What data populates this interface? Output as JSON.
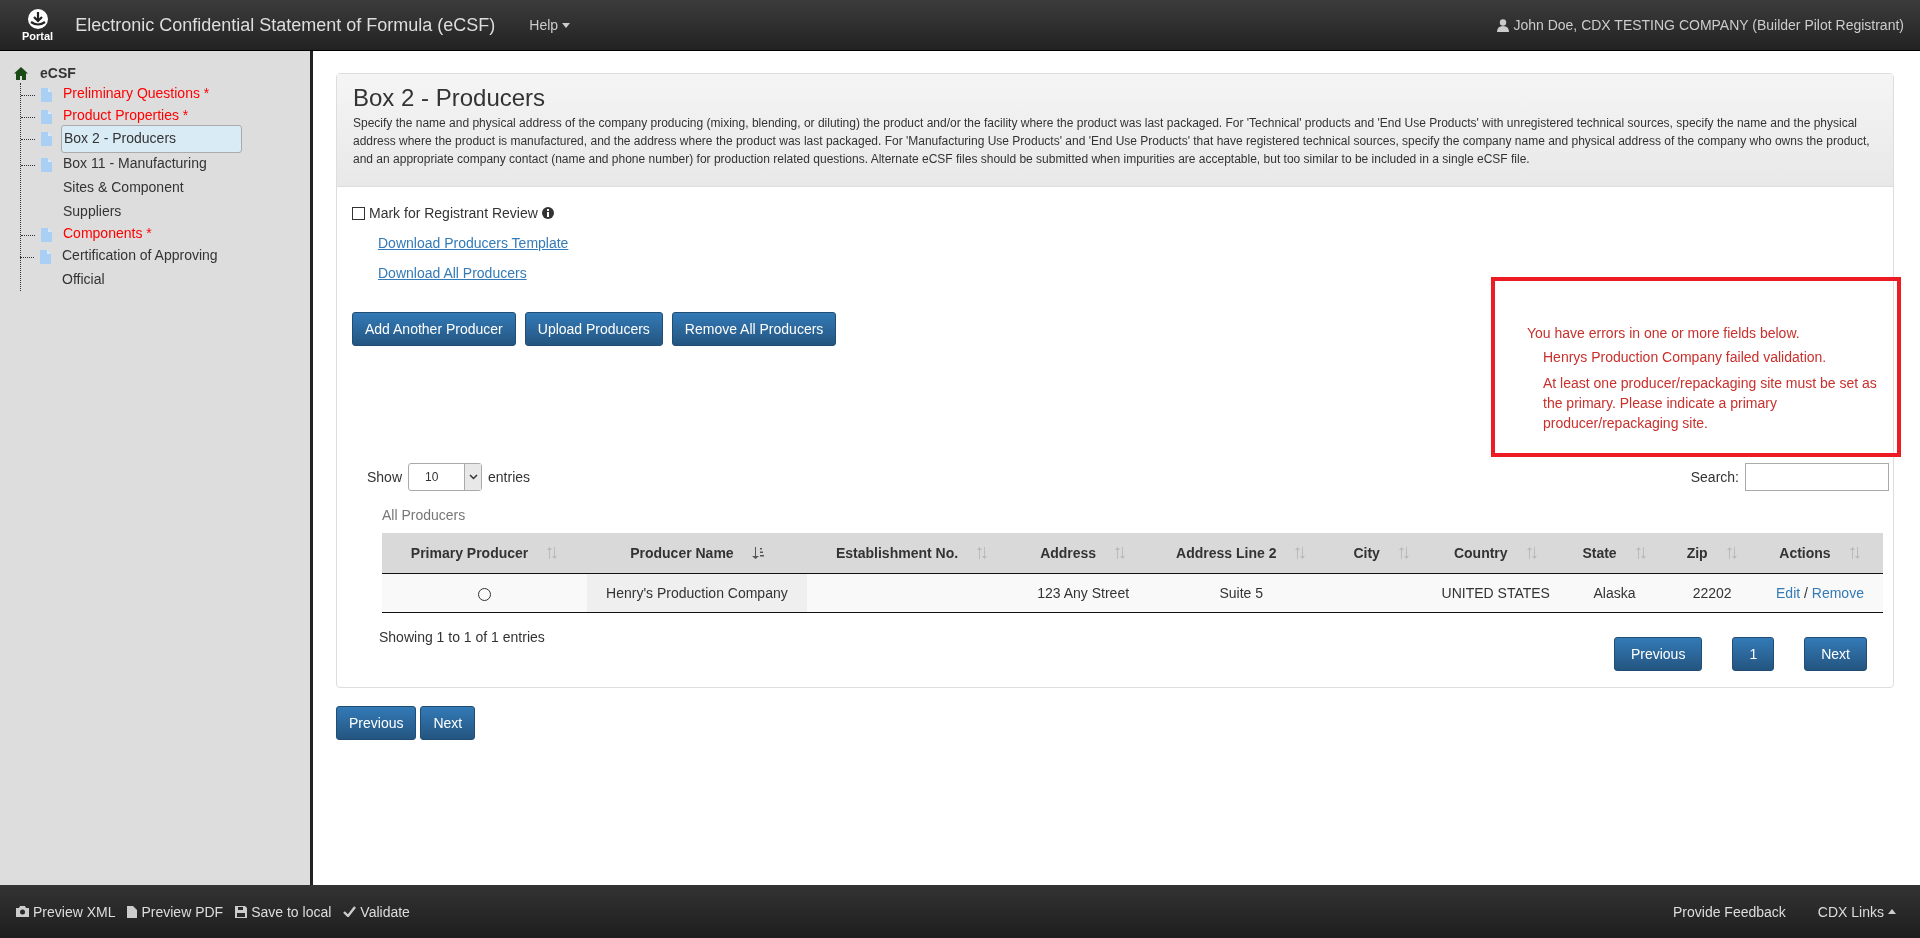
{
  "header": {
    "logo_text": "Portal",
    "title": "Electronic Confidential Statement of Formula (eCSF)",
    "help_menu": "Help",
    "user": "John Doe, CDX TESTING COMPANY (Builder Pilot Registrant)"
  },
  "sidebar": {
    "root": "eCSF",
    "items": [
      {
        "label": "Preliminary Questions *",
        "invalid": true,
        "selected": false
      },
      {
        "label": "Product Properties *",
        "invalid": true,
        "selected": false
      },
      {
        "label": "Box 2 - Producers",
        "invalid": false,
        "selected": true
      },
      {
        "label": "Box 11 - Manufacturing Sites & Component Suppliers",
        "invalid": false,
        "selected": false
      },
      {
        "label": "Components *",
        "invalid": true,
        "selected": false
      },
      {
        "label": "Certification of Approving Official",
        "invalid": false,
        "selected": false
      }
    ]
  },
  "panel": {
    "title": "Box 2 - Producers",
    "description": "Specify the name and physical address of the company producing (mixing, blending, or diluting) the product and/or the facility where the product was last packaged. For 'Technical' products and 'End Use Products' with unregistered technical sources, specify the name and the physical address where the product is manufactured, and the address where the product was last packaged. For 'Manufacturing Use Products' and 'End Use Products' that have registered technical sources, specify the company name and physical address of the company who owns the product, and an appropriate company contact (name and phone number) for production related questions. Alternate eCSF files should be submitted when impurities are acceptable, but too similar to be included in a single eCSF file.",
    "review_checkbox": {
      "label": "Mark for Registrant Review",
      "checked": false
    },
    "links": [
      "Download Producers Template",
      "Download All Producers"
    ],
    "buttons": [
      "Add Another Producer",
      "Upload Producers",
      "Remove All Producers"
    ],
    "errors": {
      "heading": "You have errors in one or more fields below.",
      "items": [
        "Henrys Production Company failed validation.",
        "At least one producer/repackaging site must be set as the primary. Please indicate a primary producer/repackaging site."
      ]
    },
    "table": {
      "show_label": "Show",
      "page_size": "10",
      "entries_label": "entries",
      "search_label": "Search:",
      "caption": "All Producers",
      "columns": [
        {
          "label": "Primary Producer",
          "sorted": false
        },
        {
          "label": "Producer Name",
          "sorted": true
        },
        {
          "label": "Establishment No.",
          "sorted": false
        },
        {
          "label": "Address",
          "sorted": false
        },
        {
          "label": "Address Line 2",
          "sorted": false
        },
        {
          "label": "City",
          "sorted": false
        },
        {
          "label": "Country",
          "sorted": false
        },
        {
          "label": "State",
          "sorted": false
        },
        {
          "label": "Zip",
          "sorted": false
        },
        {
          "label": "Actions",
          "sorted": false
        }
      ],
      "rows": [
        {
          "primary": false,
          "producer_name": "Henry's Production Company",
          "establishment_no": "",
          "address": "123 Any Street",
          "address_line_2": "Suite 5",
          "city": "",
          "country": "UNITED STATES",
          "state": "Alaska",
          "zip": "22202",
          "edit": "Edit",
          "separator": "/",
          "remove": "Remove"
        }
      ],
      "info": "Showing 1 to 1 of 1 entries",
      "pagination": [
        "Previous",
        "1",
        "Next"
      ]
    },
    "nav_buttons": [
      "Previous",
      "Next"
    ]
  },
  "footer": {
    "left": [
      {
        "kind": "camera",
        "label": "Preview XML"
      },
      {
        "kind": "file",
        "label": "Preview PDF"
      },
      {
        "kind": "save",
        "label": "Save to local"
      },
      {
        "kind": "check",
        "label": "Validate"
      }
    ],
    "feedback": "Provide Feedback",
    "links_menu": "CDX Links"
  }
}
